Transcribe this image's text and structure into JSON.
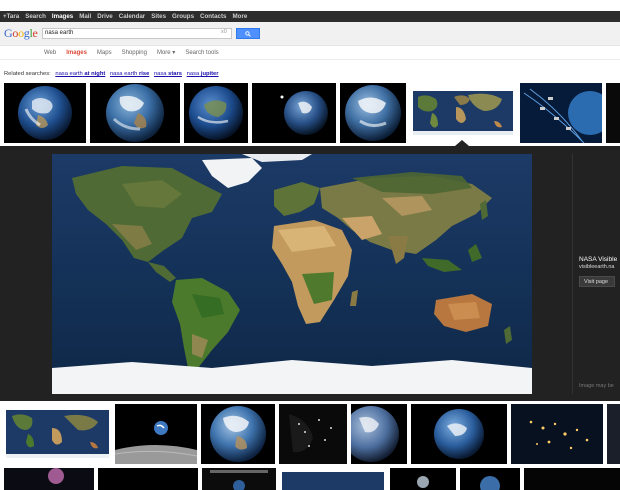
{
  "topbar": {
    "items": [
      {
        "label": "+Tara",
        "active": false
      },
      {
        "label": "Search",
        "active": false
      },
      {
        "label": "Images",
        "active": true
      },
      {
        "label": "Mail",
        "active": false
      },
      {
        "label": "Drive",
        "active": false
      },
      {
        "label": "Calendar",
        "active": false
      },
      {
        "label": "Sites",
        "active": false
      },
      {
        "label": "Groups",
        "active": false
      },
      {
        "label": "Contacts",
        "active": false
      },
      {
        "label": "More",
        "active": false
      }
    ]
  },
  "header": {
    "logo_letters": [
      "G",
      "o",
      "o",
      "g",
      "l",
      "e"
    ],
    "search_value": "nasa earth",
    "clear_symbol": "x0",
    "search_button_icon": "magnifier-icon"
  },
  "tabs": {
    "items": [
      "Web",
      "Images",
      "Maps",
      "Shopping",
      "More ▾",
      "Search tools"
    ],
    "active": "Images"
  },
  "related": {
    "label": "Related searches:",
    "items": [
      {
        "prefix": "nasa earth",
        "bold": "at night"
      },
      {
        "prefix": "nasa earth",
        "bold": "rise"
      },
      {
        "prefix": "nasa",
        "bold": "stars"
      },
      {
        "prefix": "nasa",
        "bold": "jupiter"
      }
    ]
  },
  "preview": {
    "title": "NASA Visible",
    "url": "visibleearth.na",
    "visit_label": "Visit page",
    "note": "Image may be"
  },
  "colors": {
    "accent_red": "#dd4b39",
    "link_blue": "#1a0dab",
    "search_blue": "#4d90fe",
    "panel_dark": "#222222"
  }
}
